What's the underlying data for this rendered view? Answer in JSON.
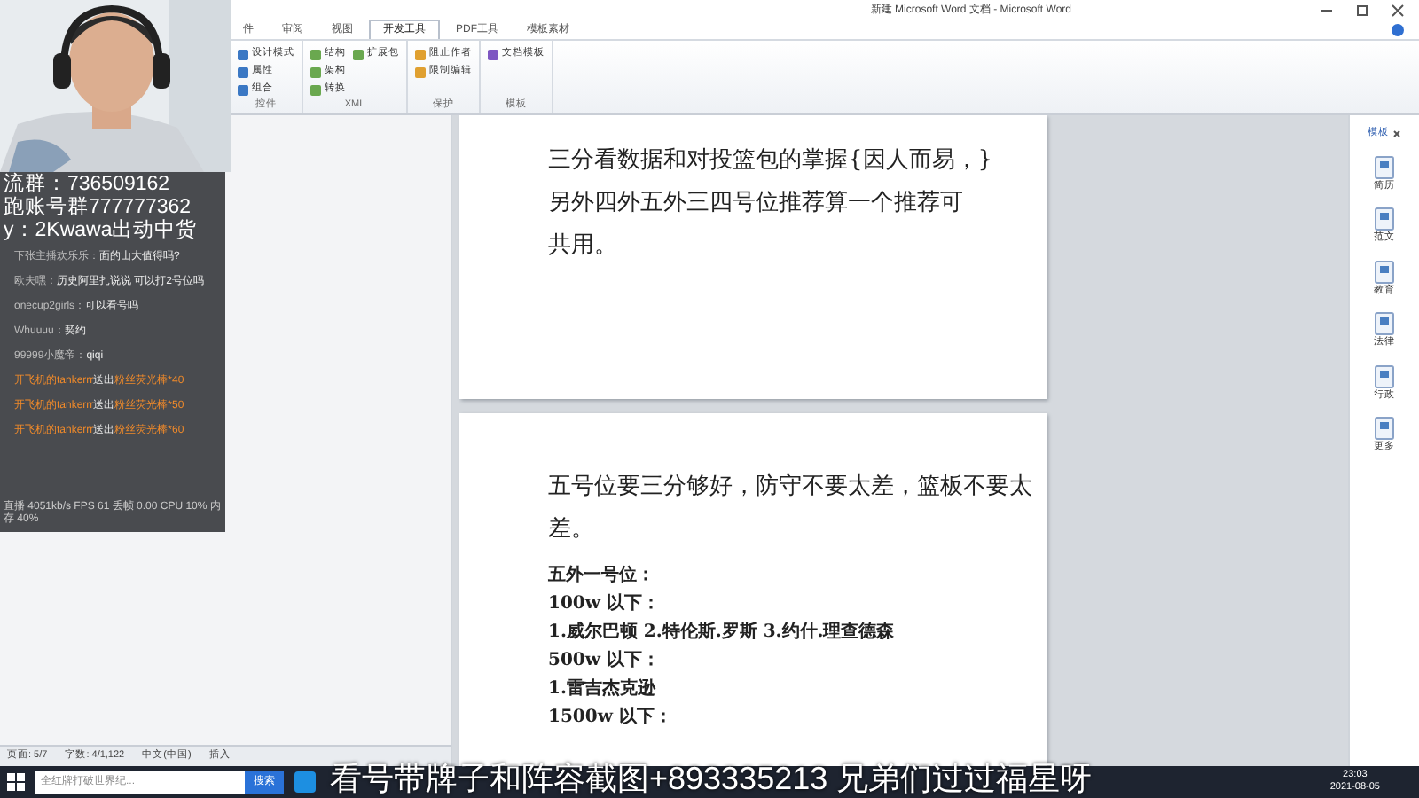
{
  "window": {
    "title": "新建 Microsoft Word 文档 - Microsoft Word"
  },
  "ribbon": {
    "tabs": [
      {
        "label": "件",
        "selected": false
      },
      {
        "label": "审阅",
        "selected": false
      },
      {
        "label": "视图",
        "selected": false
      },
      {
        "label": "开发工具",
        "selected": true
      },
      {
        "label": "PDF工具",
        "selected": false
      },
      {
        "label": "模板素材",
        "selected": false
      }
    ],
    "groups": [
      {
        "label": "控件",
        "buttons": [
          "设计模式",
          "属性",
          "组合"
        ]
      },
      {
        "label": "XML",
        "buttons": [
          "结构",
          "架构",
          "转换",
          "扩展包"
        ]
      },
      {
        "label": "保护",
        "buttons": [
          "阻止作者",
          "限制编辑"
        ]
      },
      {
        "label": "模板",
        "buttons": [
          "文档模板"
        ]
      }
    ]
  },
  "document": {
    "pages": [
      {
        "paragraphs": [
          {
            "text": "三分看数据和对投篮包的掌握{因人而易，}",
            "bold": false
          },
          {
            "text": "另外四外五外三四号位推荐算一个推荐可",
            "bold": false
          },
          {
            "text": "共用。",
            "bold": false
          }
        ]
      },
      {
        "paragraphs": [
          {
            "text": "五号位要三分够好，防守不要太差，篮板不要太差。",
            "bold": false
          },
          {
            "text": "五外一号位：",
            "bold": true
          },
          {
            "text": "100w 以下：",
            "bold": true
          },
          {
            "text": "1.威尔巴顿 2.特伦斯.罗斯 3.约什.理查德森",
            "bold": true
          },
          {
            "text": "500w 以下：",
            "bold": true
          },
          {
            "text": "1.雷吉杰克逊",
            "bold": true
          },
          {
            "text": "1500w 以下：",
            "bold": true
          }
        ]
      }
    ]
  },
  "template_pane": {
    "title": "模板",
    "items": [
      "简历",
      "范文",
      "教育",
      "法律",
      "行政",
      "更多"
    ]
  },
  "status_bar": [
    "页面: 5/7",
    "字数: 4/1,122",
    "中文(中国)",
    "插入"
  ],
  "taskbar": {
    "search_placeholder": "全红牌打破世界纪...",
    "search_button": "搜索",
    "time": "23:03",
    "date": "2021-08-05"
  },
  "stream_overlay": {
    "info_lines": [
      "流群：736509162",
      "跑账号群777777362",
      "y：2Kwawa出动中货"
    ],
    "chat": [
      {
        "kind": "message",
        "user": "下张主播欢乐乐：",
        "text": "面的山大值得吗?"
      },
      {
        "kind": "message",
        "user": "欧夫嘿：",
        "text": "历史阿里扎说说 可以打2号位吗"
      },
      {
        "kind": "message",
        "user": "onecup2girls：",
        "text": "可以看号吗"
      },
      {
        "kind": "message",
        "user": "Whuuuu：",
        "text": "契约"
      },
      {
        "kind": "message",
        "user": "99999小魔帝：",
        "text": "qiqi"
      },
      {
        "kind": "gift",
        "user": "开飞机的tankerrr",
        "action": "送出",
        "text": "粉丝荧光棒*40"
      },
      {
        "kind": "gift",
        "user": "开飞机的tankerrr",
        "action": "送出",
        "text": "粉丝荧光棒*50"
      },
      {
        "kind": "gift",
        "user": "开飞机的tankerrr",
        "action": "送出",
        "text": "粉丝荧光棒*60"
      }
    ],
    "stats": "直播 4051kb/s FPS 61 丢帧 0.00 CPU 10% 内存 40%",
    "caption": "看号带牌子和阵容截图+893335213 兄弟们过过福星呀"
  }
}
